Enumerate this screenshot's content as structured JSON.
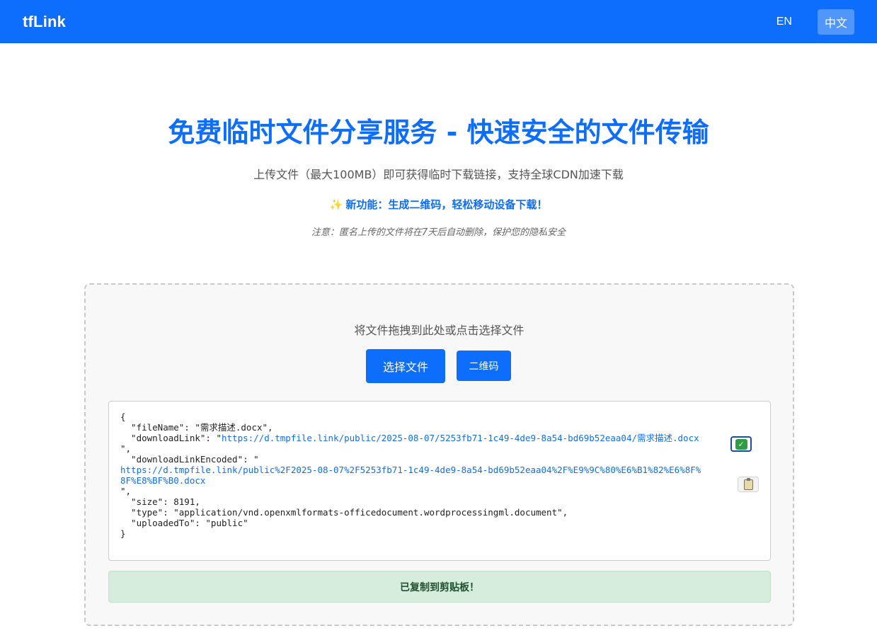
{
  "header": {
    "brand": "tfLink",
    "lang_en": "EN",
    "lang_zh": "中文",
    "active_lang": "中文"
  },
  "hero": {
    "title": "免费临时文件分享服务 - 快速安全的文件传输",
    "subtitle": "上传文件（最大100MB）即可获得临时下载链接，支持全球CDN加速下载",
    "feature": "新功能：生成二维码，轻松移动设备下载！",
    "notice": "注意：匿名上传的文件将在7天后自动删除，保护您的隐私安全"
  },
  "upload": {
    "hint": "将文件拖拽到此处或点击选择文件",
    "choose_label": "选择文件",
    "qr_label": "二维码"
  },
  "result": {
    "open_brace": "{",
    "close_brace": "}",
    "fileName_key": "  \"fileName\": ",
    "fileName_value": "\"需求描述.docx\",",
    "downloadLink_key": "  \"downloadLink\": \"",
    "downloadLink_url": "https://d.tmpfile.link/public/2025-08-07/5253fb71-1c49-4de9-8a54-bd69b52eaa04/需求描述.docx",
    "downloadLink_end": "\",",
    "downloadLinkEncoded_key": "  \"downloadLinkEncoded\": \"",
    "downloadLinkEncoded_url_1": "https://d.tmpfile.link/public%2F2025-08-07%2F5253fb71-1c49-4de9-8a54-bd69b52eaa04%2F%E9%9C%80%E6%B1%82%E6%8F%",
    "downloadLinkEncoded_url_2": "8F%E8%BF%B0.docx",
    "downloadLinkEncoded_end": "\",",
    "size_line": "  \"size\": 8191,",
    "type_line": "  \"type\": \"application/vnd.openxmlformats-officedocument.wordprocessingml.document\",",
    "uploadedTo_line": "  \"uploadedTo\": \"public\"",
    "copy_icons": [
      "check-mark-icon",
      "clipboard-icon"
    ]
  },
  "toast": {
    "message": "已复制到剪贴板！"
  },
  "colors": {
    "primary": "#0d6efd",
    "success_bg": "#d6ecdc",
    "success_text": "#1f5130"
  }
}
